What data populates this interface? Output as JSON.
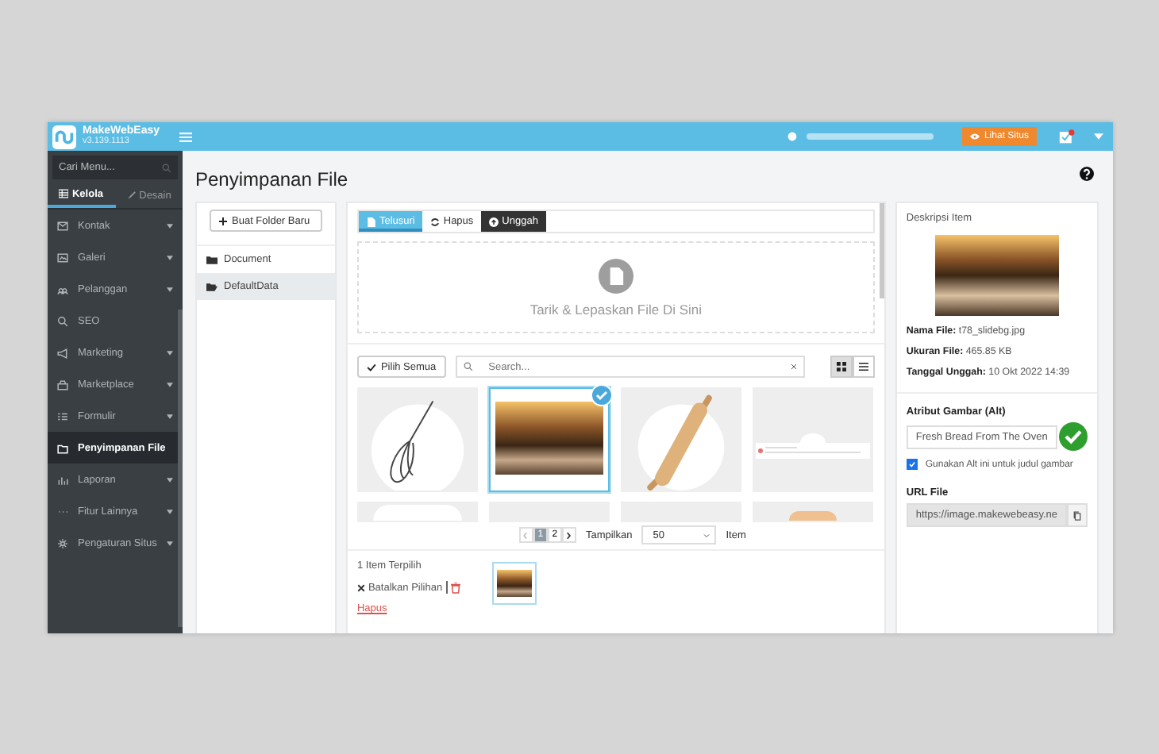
{
  "header": {
    "brand": "MakeWebEasy",
    "version": "v3.139.1113",
    "view_site_button": "Lihat Situs",
    "has_notification": true
  },
  "sidebar": {
    "search_placeholder": "Cari Menu...",
    "tabs": [
      {
        "label": "Kelola",
        "selected": true
      },
      {
        "label": "Desain",
        "selected": false
      }
    ],
    "items": [
      {
        "label": "Kontak",
        "has_submenu": true,
        "selected": false
      },
      {
        "label": "Galeri",
        "has_submenu": true,
        "selected": false
      },
      {
        "label": "Pelanggan",
        "has_submenu": true,
        "selected": false
      },
      {
        "label": "SEO",
        "has_submenu": false,
        "selected": false
      },
      {
        "label": "Marketing",
        "has_submenu": true,
        "selected": false
      },
      {
        "label": "Marketplace",
        "has_submenu": true,
        "selected": false
      },
      {
        "label": "Formulir",
        "has_submenu": true,
        "selected": false
      },
      {
        "label": "Penyimpanan File",
        "has_submenu": false,
        "selected": true
      },
      {
        "label": "Laporan",
        "has_submenu": true,
        "selected": false
      },
      {
        "label": "Fitur Lainnya",
        "has_submenu": true,
        "selected": false
      },
      {
        "label": "Pengaturan Situs",
        "has_submenu": true,
        "selected": false
      }
    ]
  },
  "page_title": "Penyimpanan File",
  "folders": {
    "new_folder_button": "Buat Folder Baru",
    "items": [
      {
        "label": "Document",
        "selected": false
      },
      {
        "label": "DefaultData",
        "selected": true
      }
    ]
  },
  "browser": {
    "tabs": [
      {
        "label": "Telusuri",
        "kind": "primary",
        "selected": true
      },
      {
        "label": "Hapus",
        "kind": "default",
        "selected": false
      },
      {
        "label": "Unggah",
        "kind": "dark",
        "selected": false
      }
    ],
    "dropzone_text": "Tarik & Lepaskan File Di Sini",
    "select_all_button": "Pilih Semua",
    "search_placeholder": "Search...",
    "views": [
      {
        "kind": "grid",
        "selected": true
      },
      {
        "kind": "list",
        "selected": false
      }
    ],
    "files": [
      {
        "kind": "whisk",
        "selected": false
      },
      {
        "kind": "photo",
        "selected": true
      },
      {
        "kind": "rolling-pin",
        "selected": false
      },
      {
        "kind": "document",
        "selected": false
      },
      {
        "kind": "plate",
        "selected": false
      },
      {
        "kind": "blank",
        "selected": false
      },
      {
        "kind": "blank",
        "selected": false
      },
      {
        "kind": "bun",
        "selected": false
      }
    ],
    "pages": [
      {
        "label": "1",
        "selected": true
      },
      {
        "label": "2",
        "selected": false
      }
    ],
    "show_label": "Tampilkan",
    "page_size": "50",
    "items_label": "Item",
    "selection_count": "1 Item Terpilih",
    "cancel_selection": "Batalkan Pilihan",
    "delete_link": "Hapus"
  },
  "details": {
    "title": "Deskripsi Item",
    "fields": [
      {
        "label": "Nama File:",
        "value": "t78_slidebg.jpg"
      },
      {
        "label": "Ukuran File:",
        "value": "465.85  KB"
      },
      {
        "label": "Tanggal Unggah:",
        "value": "10 Okt 2022 14:39"
      }
    ],
    "alt_label": "Atribut Gambar (Alt)",
    "alt_value": "Fresh Bread From The Oven",
    "alt_valid": true,
    "use_alt_as_title": {
      "label": "Gunakan Alt ini untuk judul gambar",
      "checked": true
    },
    "url_label": "URL File",
    "url_value": "https://image.makewebeasy.ne"
  }
}
